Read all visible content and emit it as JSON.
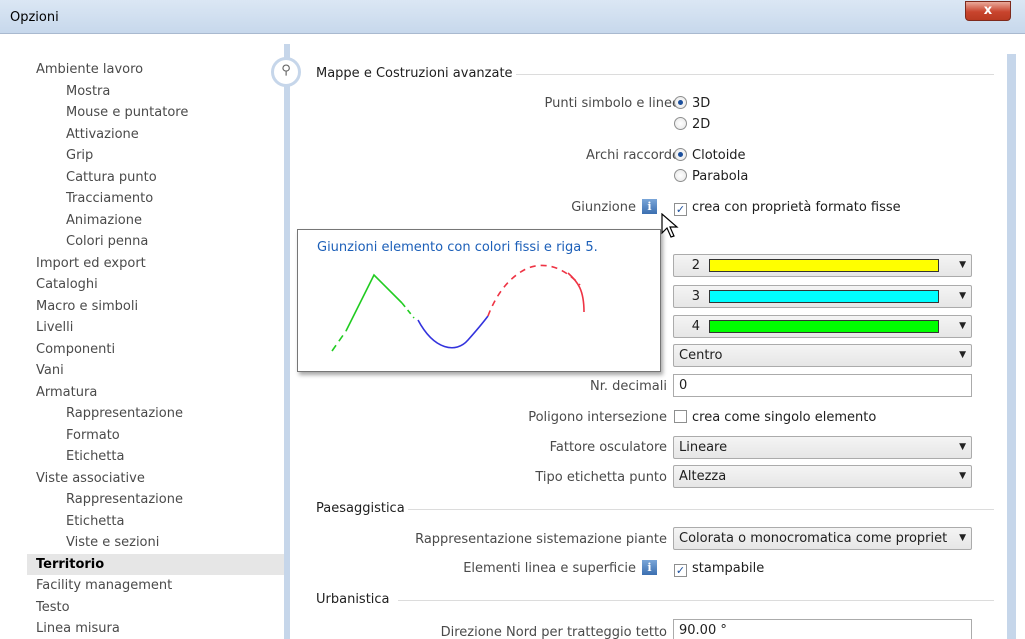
{
  "window": {
    "title": "Opzioni",
    "close_label": "x"
  },
  "tree": [
    {
      "label": "Ambiente lavoro",
      "level": 0
    },
    {
      "label": "Mostra",
      "level": 1
    },
    {
      "label": "Mouse e puntatore",
      "level": 1
    },
    {
      "label": "Attivazione",
      "level": 1
    },
    {
      "label": "Grip",
      "level": 1
    },
    {
      "label": "Cattura punto",
      "level": 1
    },
    {
      "label": "Tracciamento",
      "level": 1
    },
    {
      "label": "Animazione",
      "level": 1
    },
    {
      "label": "Colori penna",
      "level": 1
    },
    {
      "label": "Import ed export",
      "level": 0
    },
    {
      "label": "Cataloghi",
      "level": 0
    },
    {
      "label": "Macro e simboli",
      "level": 0
    },
    {
      "label": "Livelli",
      "level": 0
    },
    {
      "label": "Componenti",
      "level": 0
    },
    {
      "label": "Vani",
      "level": 0
    },
    {
      "label": "Armatura",
      "level": 0
    },
    {
      "label": "Rappresentazione",
      "level": 1
    },
    {
      "label": "Formato",
      "level": 1
    },
    {
      "label": "Etichetta",
      "level": 1
    },
    {
      "label": "Viste associative",
      "level": 0
    },
    {
      "label": "Rappresentazione",
      "level": 1
    },
    {
      "label": "Etichetta",
      "level": 1
    },
    {
      "label": "Viste e sezioni",
      "level": 1
    },
    {
      "label": "Territorio",
      "level": 0,
      "selected": true
    },
    {
      "label": "Facility management",
      "level": 0
    },
    {
      "label": "Testo",
      "level": 0
    },
    {
      "label": "Linea misura",
      "level": 0
    }
  ],
  "sections": {
    "mappe": "Mappe e Costruzioni avanzate",
    "paesaggistica": "Paesaggistica",
    "urbanistica": "Urbanistica"
  },
  "settings": {
    "punti_label": "Punti simbolo e linee",
    "punti_opt1": "3D",
    "punti_opt2": "2D",
    "archi_label": "Archi raccordo",
    "archi_opt1": "Clotoide",
    "archi_opt2": "Parabola",
    "giunzione_label": "Giunzione",
    "giunzione_check": "crea con proprietà formato fisse",
    "pen1": "2",
    "pen2": "3",
    "pen3": "4",
    "pen1_color": "#ffff00",
    "pen2_color": "#00ffff",
    "pen3_color": "#00ff00",
    "centro_value": "Centro",
    "decimali_label": "Nr. decimali",
    "decimali_value": "0",
    "poligono_label": "Poligono intersezione",
    "poligono_check": "crea come singolo elemento",
    "fattore_label": "Fattore osculatore",
    "fattore_value": "Lineare",
    "etichetta_label": "Tipo etichetta punto",
    "etichetta_value": "Altezza",
    "rappresentazione_label": "Rappresentazione sistemazione piante",
    "rappresentazione_value": "Colorata o monocromatica come propriet",
    "elementi_label": "Elementi linea e superficie",
    "elementi_check": "stampabile",
    "direzione_label": "Direzione Nord per tratteggio tetto",
    "direzione_value": "90.00 °"
  },
  "tooltip": {
    "text": "Giunzioni elemento con colori fissi e riga 5.",
    "colors": {
      "green": "#22cc22",
      "blue": "#3333dd",
      "red": "#ee3344"
    }
  },
  "icons": {
    "search": "search-icon",
    "info": "info-icon",
    "cursor": "arrow-cursor-icon"
  }
}
